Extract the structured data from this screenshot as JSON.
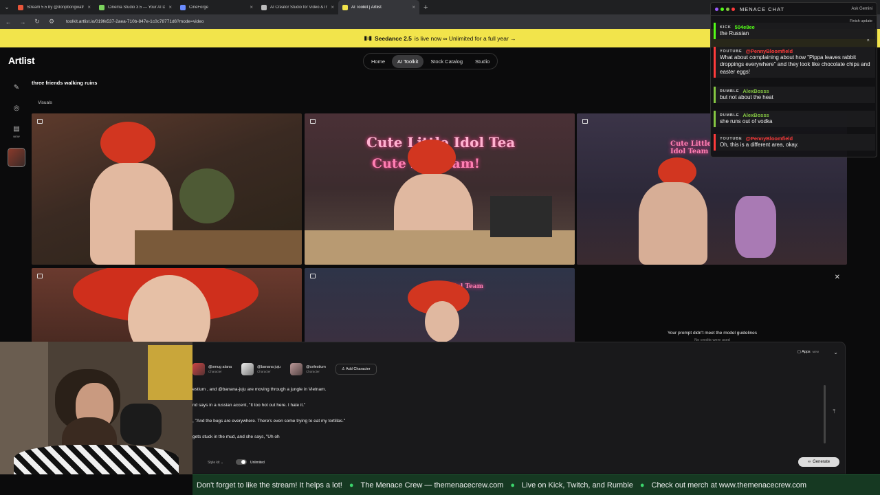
{
  "browser": {
    "tabs": [
      {
        "title": "Stream 5.5 by @donpbongwath",
        "color": "#e8553a",
        "active": false
      },
      {
        "title": "Cinema Studio 3.5 — Your AI D",
        "color": "#7bd35d",
        "active": false
      },
      {
        "title": "CineForge",
        "color": "#6b8cff",
        "active": false
      },
      {
        "title": "AI Creator Studio for Video & In",
        "color": "#bbbbbb",
        "active": false
      },
      {
        "title": "AI Toolkit | Artlist",
        "color": "#f2e44b",
        "active": true
      }
    ],
    "url": "toolkit.artlist.io/019fe537-2aea-710b-847e-1c0c78771d6?mode=video",
    "ask_gemini": "Ask Gemini",
    "finish_update": "Finish update"
  },
  "banner": {
    "brand": "Seedance 2.5",
    "text": "is live now ∞ Unlimited for a full year →"
  },
  "app": {
    "logo": "Artlist",
    "nav": [
      "Home",
      "AI Toolkit",
      "Stock Catalog",
      "Studio"
    ],
    "nav_active": "AI Toolkit",
    "rail_new": "NEW",
    "project_title": "three friends walking ruins",
    "section": "Visuals",
    "error": {
      "title": "Your prompt didn't meet the model guidelines",
      "subtitle": "No credits were used"
    },
    "captions": {
      "c2": "Cute Little Idol Tea",
      "c2b": "Cute   rle Team!",
      "c3": "Cute Little Idol Team",
      "c5": "Little Idol Team"
    }
  },
  "composer": {
    "characters": [
      {
        "name": "@smug alana",
        "type": "Character"
      },
      {
        "name": "@banana juju",
        "type": "Character"
      },
      {
        "name": "@celestium",
        "type": "Character"
      }
    ],
    "add_character": "Add Character",
    "apps": "Apps",
    "apps_badge": "NEW",
    "prompt_lines": [
      "estium  , and  @banana-juju  are moving through a jungle in Vietnam.",
      "nd says in a russian accent, \"It too hot out here. I hate it.\"",
      ", \"And the bugs are everywhere. There's even some trying to eat my tortillas.\"",
      " gets stuck in the mud, and she says, \"Uh oh"
    ],
    "style_kit": "Style kit",
    "unlimited": "Unlimited",
    "generate": "Generate"
  },
  "chat": {
    "title": "MENACE CHAT",
    "messages": [
      {
        "platform": "KICK",
        "user": "504e8ee",
        "user_color": "#53fc18",
        "text": "the Russian"
      },
      {
        "platform": "YOUTUBE",
        "user": "@PennyBloomfield",
        "user_color": "#ff3b3b",
        "text": "What about complaining about how \"Pippa leaves rabbit droppings everywhere\" and they look like chocolate chips and easter eggs!"
      },
      {
        "platform": "RUMBLE",
        "user": "AlexBosss",
        "user_color": "#85c742",
        "text": "but not about the heat"
      },
      {
        "platform": "RUMBLE",
        "user": "AlexBosss",
        "user_color": "#85c742",
        "text": "she runs out of vodka"
      },
      {
        "platform": "YOUTUBE",
        "user": "@PennyBloomfield",
        "user_color": "#ff3b3b",
        "text": "Oh, this is a different area, okay."
      }
    ]
  },
  "ticker": [
    "Don't forget to like the stream! It helps a lot!",
    "The Menace Crew — themenacecrew.com",
    "Live on Kick, Twitch, and Rumble",
    "Check out merch at www.themenacecrew.com"
  ]
}
